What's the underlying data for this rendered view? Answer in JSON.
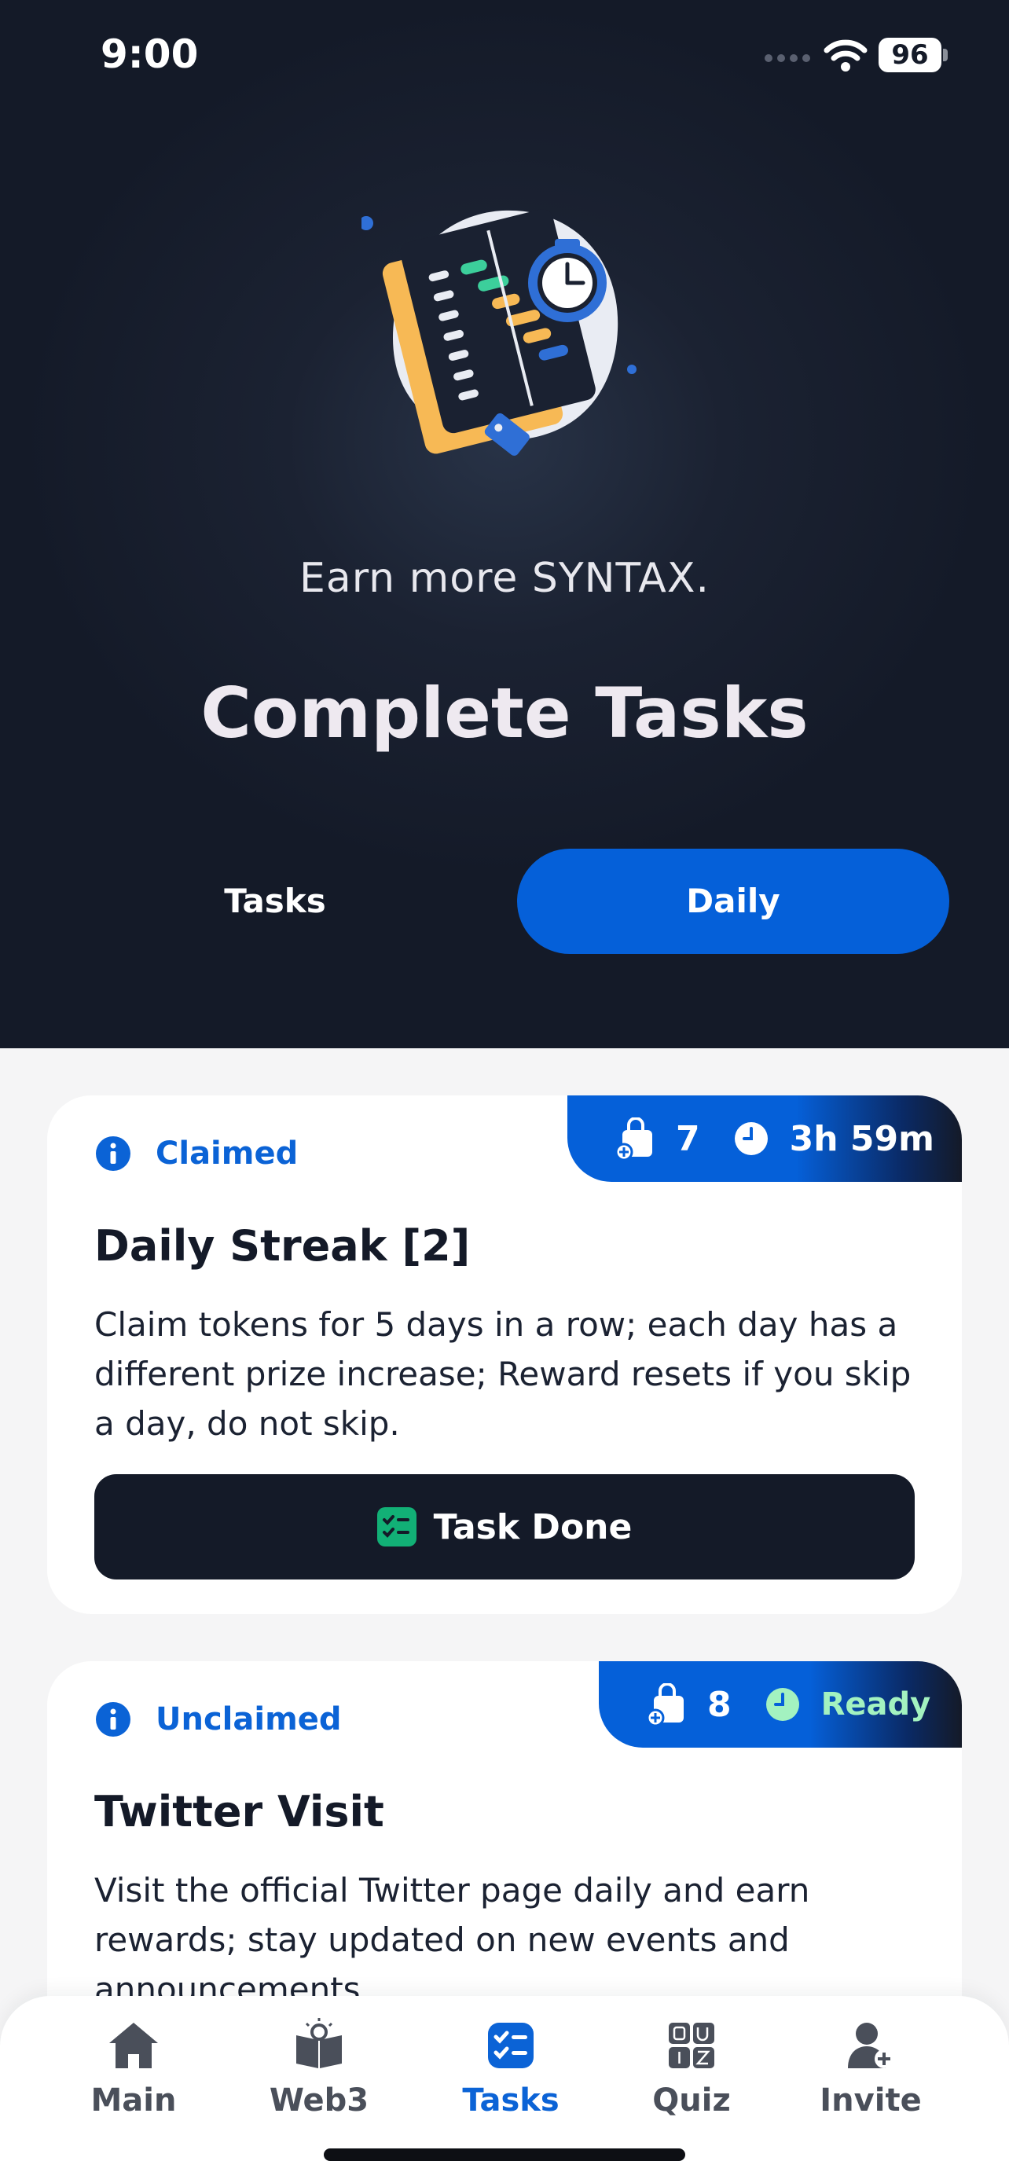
{
  "status_bar": {
    "time": "9:00",
    "battery": "96"
  },
  "header": {
    "subtitle": "Earn more SYNTAX.",
    "title": "Complete Tasks",
    "tabs": [
      {
        "label": "Tasks",
        "active": false
      },
      {
        "label": "Daily",
        "active": true
      }
    ]
  },
  "tasks": [
    {
      "status": "Claimed",
      "reward": "7",
      "timer": "3h 59m",
      "title": "Daily Streak [2]",
      "description": "Claim tokens for 5 days in a row; each day has a different prize increase; Reward resets if you skip a day, do not skip.",
      "button_label": "Task Done"
    },
    {
      "status": "Unclaimed",
      "reward": "8",
      "timer": "Ready",
      "title": "Twitter Visit",
      "description": "Visit the official Twitter page daily and earn rewards; stay updated on new events and announcements."
    }
  ],
  "nav": {
    "items": [
      {
        "label": "Main",
        "icon": "home-icon"
      },
      {
        "label": "Web3",
        "icon": "book-icon"
      },
      {
        "label": "Tasks",
        "icon": "tasks-icon",
        "active": true
      },
      {
        "label": "Quiz",
        "icon": "quiz-icon"
      },
      {
        "label": "Invite",
        "icon": "invite-icon"
      }
    ]
  },
  "colors": {
    "accent": "#0560d9",
    "dark": "#141a28",
    "ready": "#a3f2c0",
    "success": "#12b076"
  }
}
